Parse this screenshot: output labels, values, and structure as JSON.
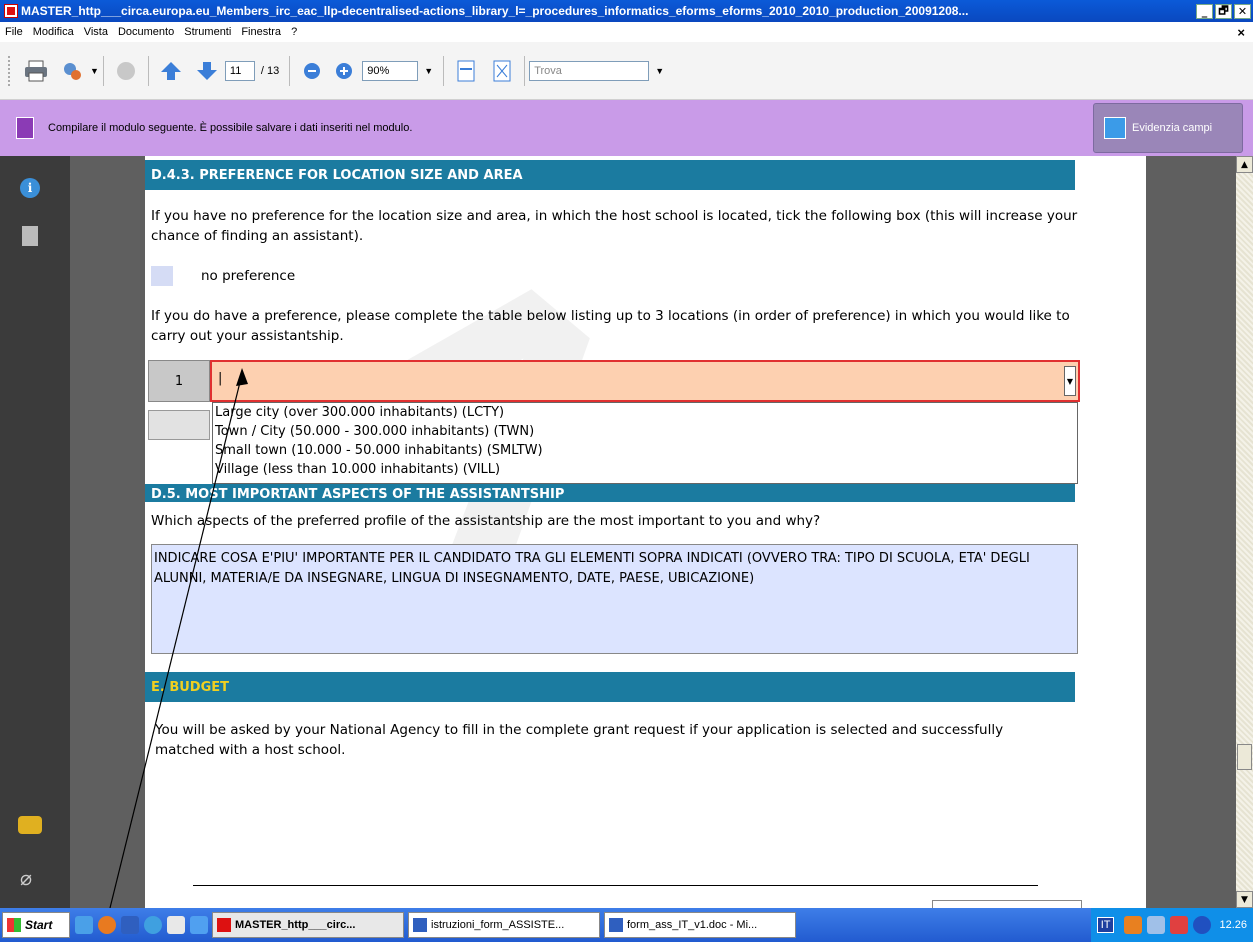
{
  "window": {
    "title": "MASTER_http___circa.europa.eu_Members_irc_eac_llp-decentralised-actions_library_l=_procedures_informatics_eforms_eforms_2010_2010_production_20091208...",
    "controls": [
      "_",
      "🗗",
      "✕"
    ]
  },
  "menu": {
    "items": [
      "File",
      "Modifica",
      "Vista",
      "Documento",
      "Strumenti",
      "Finestra",
      "?"
    ],
    "close": "×"
  },
  "toolbar": {
    "page_current": "11",
    "page_total": "/ 13",
    "zoom": "90%",
    "find_placeholder": "Trova"
  },
  "formbar": {
    "message": "Compilare il modulo seguente. È possibile salvare i dati inseriti nel modulo.",
    "highlight_label": "Evidenzia campi"
  },
  "document": {
    "section_d43_title": "D.4.3. PREFERENCE FOR LOCATION SIZE AND AREA",
    "d43_intro": "If you have no preference for the location size and area, in which the host school is located, tick the following box (this will increase your chance of finding an assistant).",
    "no_preference_label": "no preference",
    "d43_table_intro": "If you do have a preference, please complete the table below listing up to 3 locations (in order of preference) in which you would like to carry out your assistantship.",
    "row1_number": "1",
    "dropdown_value": "|",
    "dropdown_options": [
      "Large city (over 300.000 inhabitants) (LCTY)",
      "Town / City (50.000 - 300.000 inhabitants) (TWN)",
      "Small town (10.000 - 50.000 inhabitants) (SMLTW)",
      "Village (less than 10.000 inhabitants) (VILL)"
    ],
    "section_d5_title": "D.5. MOST IMPORTANT ASPECTS OF THE ASSISTANTSHIP",
    "d5_question": "Which aspects of the preferred profile of the assistantship are the most important to you and why?",
    "d5_answer": "INDICARE COSA E'PIU' IMPORTANTE PER IL CANDIDATO TRA GLI ELEMENTI SOPRA INDICATI (OVVERO TRA: TIPO DI SCUOLA, ETA' DEGLI ALUNNI, MATERIA/E DA INSEGNARE, LINGUA DI INSEGNAMENTO, DATE, PAESE, UBICAZIONE)",
    "section_e_title": "E. BUDGET",
    "e_text": "You will be asked by your National Agency to fill in the complete grant request if your application is selected and successfully matched with a host school."
  },
  "taskbar": {
    "start_label": "Start",
    "tasks": [
      "MASTER_http___circ...",
      "istruzioni_form_ASSISTE...",
      "form_ass_IT_v1.doc - Mi..."
    ],
    "lang": "IT",
    "clock": "12.26"
  },
  "colors": {
    "section_header": "#1b7ba0",
    "section_e_title_color": "#f0d020",
    "formbar_bg": "#c99be8",
    "dropdown_bg": "#fdd0b0",
    "dropdown_border": "#e03030",
    "field_bg": "#dce4ff"
  }
}
